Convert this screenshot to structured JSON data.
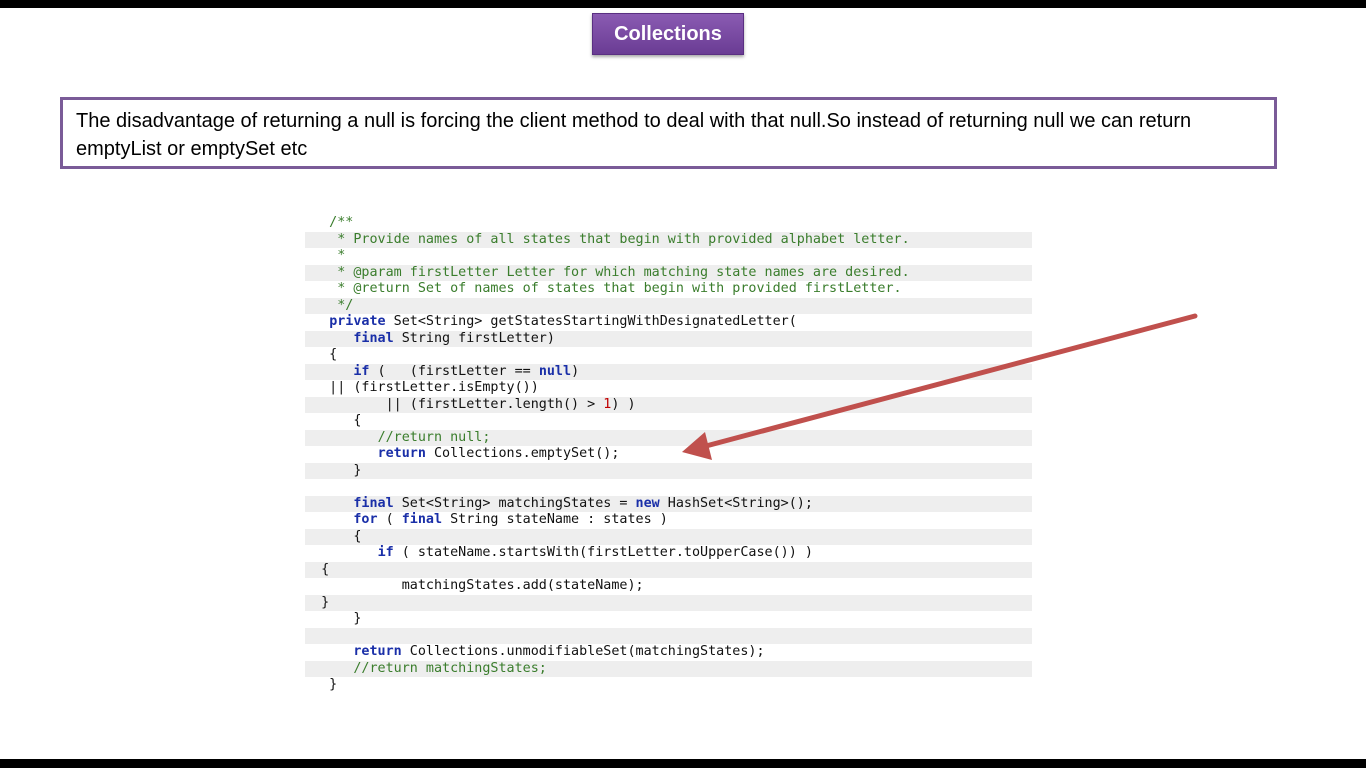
{
  "slide": {
    "title": "Collections",
    "description": "The disadvantage of returning a null is forcing the client  method to deal with that null.So instead of returning null we can return emptyList or emptySet etc"
  },
  "code": {
    "lines": [
      [
        {
          "t": "   /**",
          "c": "cm"
        }
      ],
      [
        {
          "t": "    * Provide names of all states that begin with provided alphabet letter.",
          "c": "cm"
        }
      ],
      [
        {
          "t": "    *",
          "c": "cm"
        }
      ],
      [
        {
          "t": "    * @param firstLetter Letter for which matching state names are desired.",
          "c": "cm"
        }
      ],
      [
        {
          "t": "    * @return Set of names of states that begin with provided firstLetter.",
          "c": "cm"
        }
      ],
      [
        {
          "t": "    */",
          "c": "cm"
        }
      ],
      [
        {
          "t": "   "
        },
        {
          "t": "private",
          "c": "kw"
        },
        {
          "t": " Set<String> getStatesStartingWithDesignatedLetter("
        }
      ],
      [
        {
          "t": "      "
        },
        {
          "t": "final",
          "c": "kw"
        },
        {
          "t": " String firstLetter)"
        }
      ],
      [
        {
          "t": "   {"
        }
      ],
      [
        {
          "t": "      "
        },
        {
          "t": "if",
          "c": "kw"
        },
        {
          "t": " (   (firstLetter == "
        },
        {
          "t": "null",
          "c": "kw"
        },
        {
          "t": ")"
        }
      ],
      [
        {
          "t": "   || (firstLetter.isEmpty())"
        }
      ],
      [
        {
          "t": "          || (firstLetter.length() > "
        },
        {
          "t": "1",
          "c": "num"
        },
        {
          "t": ") )"
        }
      ],
      [
        {
          "t": "      {"
        }
      ],
      [
        {
          "t": "         "
        },
        {
          "t": "//return null;",
          "c": "cm"
        }
      ],
      [
        {
          "t": "         "
        },
        {
          "t": "return",
          "c": "kw"
        },
        {
          "t": " Collections.emptySet();"
        }
      ],
      [
        {
          "t": "      }"
        }
      ],
      [
        {
          "t": ""
        }
      ],
      [
        {
          "t": "      "
        },
        {
          "t": "final",
          "c": "kw"
        },
        {
          "t": " Set<String> matchingStates = "
        },
        {
          "t": "new",
          "c": "kw"
        },
        {
          "t": " HashSet<String>();"
        }
      ],
      [
        {
          "t": "      "
        },
        {
          "t": "for",
          "c": "kw"
        },
        {
          "t": " ( "
        },
        {
          "t": "final",
          "c": "kw"
        },
        {
          "t": " String stateName : states )"
        }
      ],
      [
        {
          "t": "      {"
        }
      ],
      [
        {
          "t": "         "
        },
        {
          "t": "if",
          "c": "kw"
        },
        {
          "t": " ( stateName.startsWith(firstLetter.toUpperCase()) )"
        }
      ],
      [
        {
          "t": "  {"
        }
      ],
      [
        {
          "t": "            matchingStates.add(stateName);"
        }
      ],
      [
        {
          "t": "  }"
        }
      ],
      [
        {
          "t": "      }"
        }
      ],
      [
        {
          "t": ""
        }
      ],
      [
        {
          "t": "      "
        },
        {
          "t": "return",
          "c": "kw"
        },
        {
          "t": " Collections.unmodifiableSet(matchingStates);"
        }
      ],
      [
        {
          "t": "      "
        },
        {
          "t": "//return matchingStates;",
          "c": "cm"
        }
      ],
      [
        {
          "t": "   }"
        }
      ]
    ]
  },
  "colors": {
    "title_bg": "#7b4ca6",
    "box_border": "#7a5b98",
    "arrow": "#c0504d"
  }
}
